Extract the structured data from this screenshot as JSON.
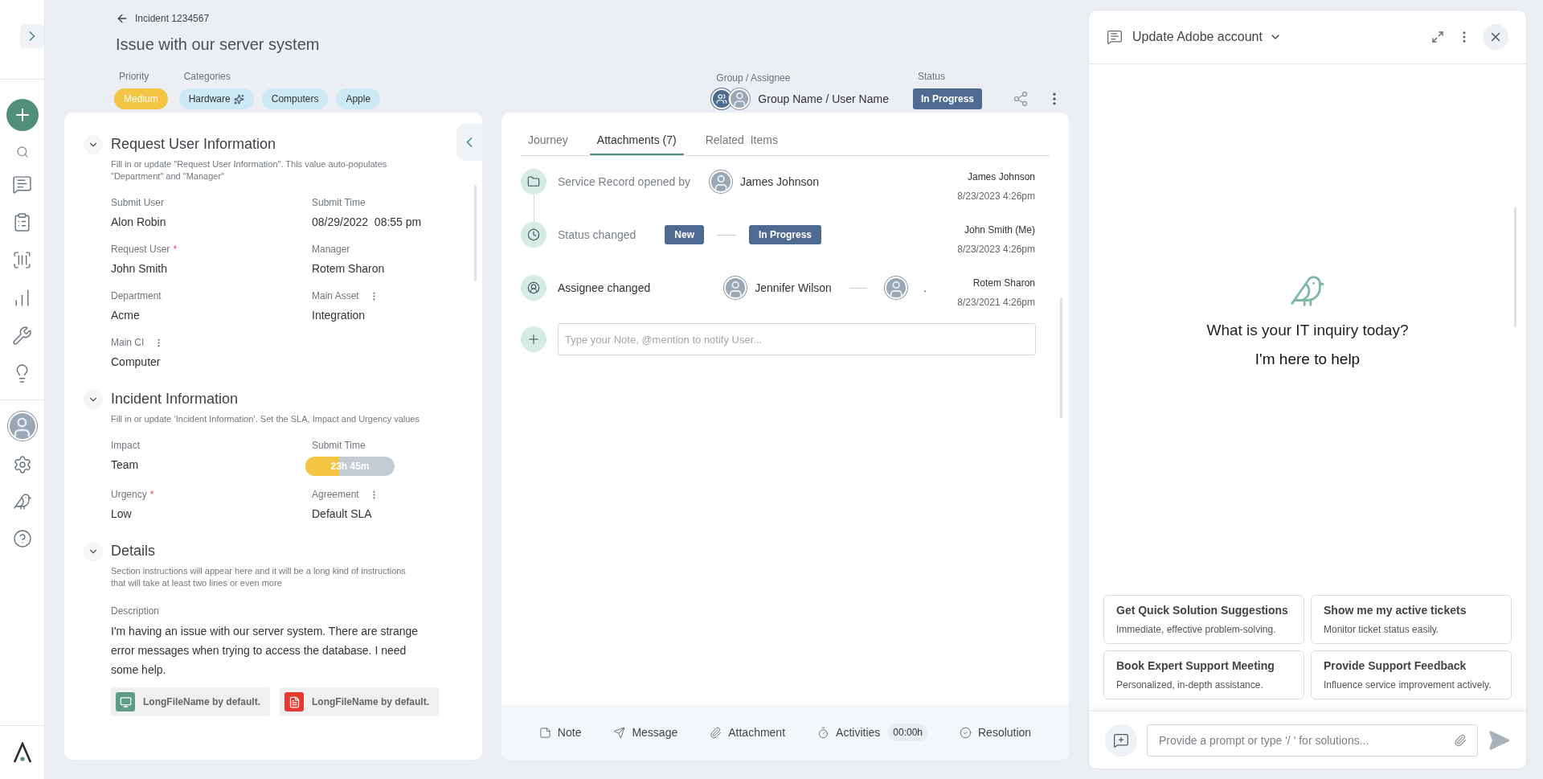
{
  "header": {
    "back_label": "Incident 1234567",
    "title": "Issue with our server system",
    "priority": {
      "label": "Priority",
      "value": "Medium",
      "color": "#f4c542"
    },
    "categories": {
      "label": "Categories",
      "items": [
        {
          "label": "Hardware",
          "ai": true
        },
        {
          "label": "Computers",
          "ai": false
        },
        {
          "label": "Apple",
          "ai": false
        }
      ]
    },
    "assignee": {
      "label": "Group / Assignee",
      "value": "Group Name / User Name"
    },
    "status": {
      "label": "Status",
      "value": "In Progress"
    }
  },
  "sections": [
    {
      "title": "Request User Information",
      "expanded": true,
      "hint": "Fill in or update \"Request User Information\". This value auto-populates \"Department\" and \"Manager\"",
      "fields": [
        {
          "kind": "text",
          "label": "Submit User",
          "value": "Alon Robin",
          "required": false
        },
        {
          "kind": "text",
          "label": "Submit Time",
          "value": "08/29/2022  08:55 pm",
          "required": false
        },
        {
          "kind": "text",
          "label": "Request User",
          "value": "John Smith",
          "required": true,
          "required_mark": "*"
        },
        {
          "kind": "text",
          "label": "Manager",
          "value": "Rotem Sharon",
          "required": false
        },
        {
          "kind": "text",
          "label": "Department",
          "value": "Acme",
          "required": false
        },
        {
          "kind": "menu_text",
          "label": "Main Asset",
          "value": "Integration",
          "required": false
        },
        {
          "kind": "menu_text",
          "label": "Main CI",
          "value": "Computer",
          "required": false
        }
      ]
    },
    {
      "title": "Incident Information",
      "expanded": true,
      "hint": "Fill in or update ‘Incident Information’. Set the SLA, Impact and Urgency values",
      "fields": [
        {
          "kind": "text",
          "label": "Impact",
          "value": "Team",
          "required": false
        },
        {
          "kind": "timer",
          "label": "Submit Time",
          "value": "23h 45m",
          "level": 0.38,
          "required": false
        },
        {
          "kind": "text",
          "label": "Urgency",
          "value": "Low",
          "required": true,
          "required_mark": "*"
        },
        {
          "kind": "menu_text",
          "label": "Agreement",
          "value": "Default SLA",
          "required": false
        }
      ]
    },
    {
      "title": "Details",
      "expanded": true,
      "hint": "Section instructions will appear here and it will be a long kind of instructions that will take at least two lines or even more",
      "description": {
        "label": "Description",
        "value": "I'm having an issue with our server system. There are strange error messages when trying to access the database. I need some help."
      },
      "files": [
        {
          "kind": "image",
          "name": "LongFileName by default."
        },
        {
          "kind": "pdf",
          "name": "LongFileName by default."
        }
      ]
    }
  ],
  "tabs": [
    {
      "label": "Journey",
      "selected": false
    },
    {
      "label": "Attachments (7)",
      "selected": true
    },
    {
      "label": "Related  Items",
      "selected": false
    }
  ],
  "timeline": [
    {
      "kind": "opened",
      "text": "Service Record opened by",
      "person": "James Johnson",
      "author": "James Johnson",
      "time": "8/23/2023 4:26pm"
    },
    {
      "kind": "status",
      "text": "Status changed",
      "from": "New",
      "to": "In Progress",
      "author": "John Smith (Me)",
      "time": "8/23/2023 4:26pm"
    },
    {
      "kind": "assignee",
      "text": "Assignee changed",
      "from": "Jennifer Wilson",
      "to": ".",
      "author": "Rotem Sharon",
      "time": "8/23/2021 4:26pm"
    }
  ],
  "note_field": {
    "placeholder": "Type your Note, @mention to notify User..."
  },
  "actions": [
    {
      "kind": "note",
      "label": "Note"
    },
    {
      "kind": "message",
      "label": "Message"
    },
    {
      "kind": "attachment",
      "label": "Attachment"
    },
    {
      "kind": "activities",
      "label": "Activities",
      "badge": "00:00h"
    },
    {
      "kind": "resolution",
      "label": "Resolution"
    }
  ],
  "chat": {
    "title": "Update Adobe account",
    "question": "What is your IT inquiry today?",
    "subtitle": "I'm here to help",
    "suggestions": [
      {
        "title": "Get Quick Solution Suggestions",
        "text": "Immediate, effective problem-solving."
      },
      {
        "title": "Show me my active tickets",
        "text": "Monitor ticket status easily."
      },
      {
        "title": "Book Expert Support Meeting",
        "text": "Personalized, in-depth assistance."
      },
      {
        "title": "Provide Support Feedback",
        "text": "Influence service improvement actively."
      }
    ],
    "input": {
      "placeholder": "Provide a prompt or type '/ ' for solutions..."
    }
  }
}
